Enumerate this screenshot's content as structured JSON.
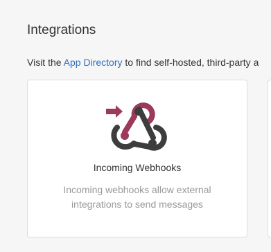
{
  "header": {
    "title": "Integrations"
  },
  "intro": {
    "prefix": "Visit the ",
    "link_text": "App Directory",
    "suffix": " to find self-hosted, third-party a"
  },
  "cards": [
    {
      "icon": "webhook-icon",
      "title": "Incoming Webhooks",
      "description": "Incoming webhooks allow external integrations to send messages"
    }
  ],
  "colors": {
    "link": "#2f6fbd",
    "icon_accent": "#9c3a5a",
    "icon_dark": "#3d3d3d",
    "muted_text": "#999999"
  }
}
